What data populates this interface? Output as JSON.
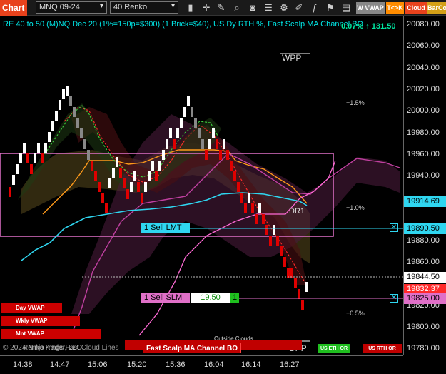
{
  "toolbar": {
    "chart_tab": "Chart",
    "instrument": "MNQ 09-24",
    "bar_type": "40 Renko",
    "wvwap_label": "W VWAP",
    "tk_label": "T<>K",
    "cloud_label": "Cloud",
    "barco_label": "BarCo",
    "colors": {
      "chart_tab": "#e8421c",
      "tk": "#ff8c00",
      "cloud": "#e8421c",
      "barco": "#d4a017",
      "wvwap_bg": "#888888"
    },
    "icons": [
      "bar-chart-icon",
      "crosshair-icon",
      "pencil-icon",
      "zoom-icon",
      "camera-icon",
      "properties-icon",
      "strategy-icon",
      "draw-tools-icon",
      "indicator-icon",
      "alert-icon",
      "volume-icon"
    ]
  },
  "chart": {
    "title": "RE 40 to 50 (M)NQ Dec 20 (1%=150p=$300) (1 Brick=$40), US Dy RTH %, Fast Scalp MA Channel BO",
    "topright": "0.07% ↑ 131.50",
    "wpp": "WPP",
    "dr1": "DR1",
    "dpp": "DPP",
    "outside_clouds": "Outside Clouds",
    "copyright": "© 2024 NinjaTrader, LLC",
    "footer_label": "Renko Kings Fast Cloud Lines",
    "fast_scalp_label": "Fast Scalp MA Channel BO",
    "pct_labels": [
      "+1.5%",
      "+1.0%",
      "+0.5%"
    ],
    "vwap_buttons": [
      "Day VWAP",
      "Wkly VWAP",
      "Mnt VWAP"
    ],
    "us_eth_or": "US ETH OR",
    "us_rth_or": "US RTH OR"
  },
  "orders": {
    "sell_lmt": "1 Sell LMT",
    "sell_lmt_price": "19890.50",
    "sell_slm": "1 Sell SLM",
    "sell_slm_offset": "19.50",
    "sell_slm_qty": "1",
    "sell_slm_price": "19825.00"
  },
  "price_axis": {
    "ticks": [
      "20080.00",
      "20060.00",
      "20040.00",
      "20020.00",
      "20000.00",
      "19980.00",
      "19960.00",
      "19940.00",
      "19880.00",
      "19860.00",
      "19820.00",
      "19800.00",
      "19780.00"
    ],
    "tags": {
      "tag_1": "19914.69",
      "tag_2": "19890.50",
      "tag_3": "19844.50",
      "tag_4": "19832.37",
      "tag_5": "19825.00"
    }
  },
  "time_axis": {
    "ticks": [
      "14:38",
      "14:47",
      "15:06",
      "15:20",
      "15:36",
      "16:04",
      "16:14",
      "16:27"
    ]
  }
}
